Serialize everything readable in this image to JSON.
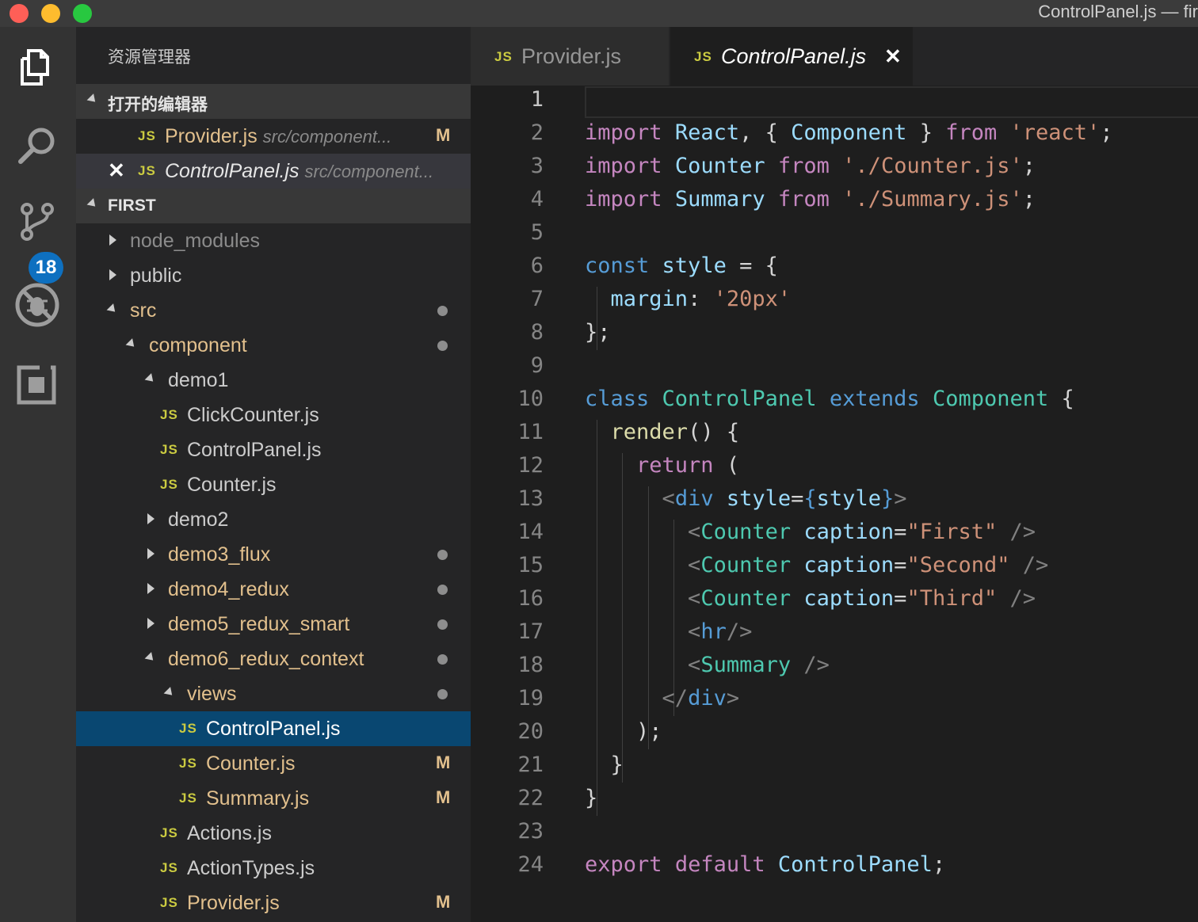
{
  "window": {
    "title": "ControlPanel.js — fir"
  },
  "activity_bar": {
    "items": [
      "explorer-icon",
      "search-icon",
      "source-control-icon",
      "debug-icon",
      "extensions-icon"
    ],
    "source_control_badge": "18"
  },
  "sidebar": {
    "title": "资源管理器",
    "open_editors_header": "打开的编辑器",
    "open_editors": [
      {
        "name": "Provider.js",
        "path": "src/component...",
        "status": "M"
      },
      {
        "name": "ControlPanel.js",
        "path": "src/component..."
      }
    ],
    "project_header": "FIRST",
    "tree": [
      {
        "label": "node_modules"
      },
      {
        "label": "public"
      },
      {
        "label": "src"
      },
      {
        "label": "component"
      },
      {
        "label": "demo1"
      },
      {
        "label": "ClickCounter.js"
      },
      {
        "label": "ControlPanel.js"
      },
      {
        "label": "Counter.js"
      },
      {
        "label": "demo2"
      },
      {
        "label": "demo3_flux"
      },
      {
        "label": "demo4_redux"
      },
      {
        "label": "demo5_redux_smart"
      },
      {
        "label": "demo6_redux_context"
      },
      {
        "label": "views"
      },
      {
        "label": "ControlPanel.js"
      },
      {
        "label": "Counter.js",
        "status": "M"
      },
      {
        "label": "Summary.js",
        "status": "M"
      },
      {
        "label": "Actions.js"
      },
      {
        "label": "ActionTypes.js"
      },
      {
        "label": "Provider.js",
        "status": "M"
      }
    ],
    "js_badge": "JS"
  },
  "tabs": [
    {
      "label": "Provider.js"
    },
    {
      "label": "ControlPanel.js",
      "close": "✕"
    }
  ],
  "colors": {
    "keyword": "#c586c0",
    "storage": "#569cd6",
    "class": "#4ec9b0",
    "variable": "#9cdcfe",
    "string": "#ce9178",
    "function": "#dcdcaa",
    "punct": "#d4d4d4",
    "tag_bracket": "#808080",
    "modified": "#e2c08d",
    "selection": "#094771"
  },
  "editor": {
    "lines": [
      {
        "n": "1",
        "tokens": []
      },
      {
        "n": "2",
        "tokens": [
          [
            "import",
            "keyword"
          ],
          [
            " ",
            "punct"
          ],
          [
            "React",
            "variable"
          ],
          [
            ", { ",
            "punct"
          ],
          [
            "Component",
            "variable"
          ],
          [
            " } ",
            "punct"
          ],
          [
            "from",
            "keyword"
          ],
          [
            " ",
            "punct"
          ],
          [
            "'react'",
            "string"
          ],
          [
            ";",
            "punct"
          ]
        ]
      },
      {
        "n": "3",
        "tokens": [
          [
            "import",
            "keyword"
          ],
          [
            " ",
            "punct"
          ],
          [
            "Counter",
            "variable"
          ],
          [
            " ",
            "punct"
          ],
          [
            "from",
            "keyword"
          ],
          [
            " ",
            "punct"
          ],
          [
            "'./Counter.js'",
            "string"
          ],
          [
            ";",
            "punct"
          ]
        ]
      },
      {
        "n": "4",
        "tokens": [
          [
            "import",
            "keyword"
          ],
          [
            " ",
            "punct"
          ],
          [
            "Summary",
            "variable"
          ],
          [
            " ",
            "punct"
          ],
          [
            "from",
            "keyword"
          ],
          [
            " ",
            "punct"
          ],
          [
            "'./Summary.js'",
            "string"
          ],
          [
            ";",
            "punct"
          ]
        ]
      },
      {
        "n": "5",
        "tokens": []
      },
      {
        "n": "6",
        "tokens": [
          [
            "const",
            "storage"
          ],
          [
            " ",
            "punct"
          ],
          [
            "style",
            "variable"
          ],
          [
            " = {",
            "punct"
          ]
        ]
      },
      {
        "n": "7",
        "tokens": [
          [
            "  ",
            "punct"
          ],
          [
            "margin",
            "variable"
          ],
          [
            ": ",
            "punct"
          ],
          [
            "'20px'",
            "string"
          ]
        ]
      },
      {
        "n": "8",
        "tokens": [
          [
            "};",
            "punct"
          ]
        ]
      },
      {
        "n": "9",
        "tokens": []
      },
      {
        "n": "10",
        "tokens": [
          [
            "class",
            "storage"
          ],
          [
            " ",
            "punct"
          ],
          [
            "ControlPanel",
            "class"
          ],
          [
            " ",
            "punct"
          ],
          [
            "extends",
            "storage"
          ],
          [
            " ",
            "punct"
          ],
          [
            "Component",
            "class"
          ],
          [
            " {",
            "punct"
          ]
        ]
      },
      {
        "n": "11",
        "tokens": [
          [
            "  ",
            "punct"
          ],
          [
            "render",
            "function"
          ],
          [
            "() {",
            "punct"
          ]
        ]
      },
      {
        "n": "12",
        "tokens": [
          [
            "    ",
            "punct"
          ],
          [
            "return",
            "keyword"
          ],
          [
            " (",
            "punct"
          ]
        ]
      },
      {
        "n": "13",
        "tokens": [
          [
            "      ",
            "punct"
          ],
          [
            "<",
            "tag_bracket"
          ],
          [
            "div",
            "storage"
          ],
          [
            " ",
            "punct"
          ],
          [
            "style",
            "variable"
          ],
          [
            "=",
            "punct"
          ],
          [
            "{",
            "storage"
          ],
          [
            "style",
            "variable"
          ],
          [
            "}",
            "storage"
          ],
          [
            ">",
            "tag_bracket"
          ]
        ]
      },
      {
        "n": "14",
        "tokens": [
          [
            "        ",
            "punct"
          ],
          [
            "<",
            "tag_bracket"
          ],
          [
            "Counter",
            "class"
          ],
          [
            " ",
            "punct"
          ],
          [
            "caption",
            "variable"
          ],
          [
            "=",
            "punct"
          ],
          [
            "\"First\"",
            "string"
          ],
          [
            " ",
            "punct"
          ],
          [
            "/>",
            "tag_bracket"
          ]
        ]
      },
      {
        "n": "15",
        "tokens": [
          [
            "        ",
            "punct"
          ],
          [
            "<",
            "tag_bracket"
          ],
          [
            "Counter",
            "class"
          ],
          [
            " ",
            "punct"
          ],
          [
            "caption",
            "variable"
          ],
          [
            "=",
            "punct"
          ],
          [
            "\"Second\"",
            "string"
          ],
          [
            " ",
            "punct"
          ],
          [
            "/>",
            "tag_bracket"
          ]
        ]
      },
      {
        "n": "16",
        "tokens": [
          [
            "        ",
            "punct"
          ],
          [
            "<",
            "tag_bracket"
          ],
          [
            "Counter",
            "class"
          ],
          [
            " ",
            "punct"
          ],
          [
            "caption",
            "variable"
          ],
          [
            "=",
            "punct"
          ],
          [
            "\"Third\"",
            "string"
          ],
          [
            " ",
            "punct"
          ],
          [
            "/>",
            "tag_bracket"
          ]
        ]
      },
      {
        "n": "17",
        "tokens": [
          [
            "        ",
            "punct"
          ],
          [
            "<",
            "tag_bracket"
          ],
          [
            "hr",
            "storage"
          ],
          [
            "/>",
            "tag_bracket"
          ]
        ]
      },
      {
        "n": "18",
        "tokens": [
          [
            "        ",
            "punct"
          ],
          [
            "<",
            "tag_bracket"
          ],
          [
            "Summary",
            "class"
          ],
          [
            " ",
            "punct"
          ],
          [
            "/>",
            "tag_bracket"
          ]
        ]
      },
      {
        "n": "19",
        "tokens": [
          [
            "      ",
            "punct"
          ],
          [
            "</",
            "tag_bracket"
          ],
          [
            "div",
            "storage"
          ],
          [
            ">",
            "tag_bracket"
          ]
        ]
      },
      {
        "n": "20",
        "tokens": [
          [
            "    );",
            "punct"
          ]
        ]
      },
      {
        "n": "21",
        "tokens": [
          [
            "  }",
            "punct"
          ]
        ]
      },
      {
        "n": "22",
        "tokens": [
          [
            "}",
            "punct"
          ]
        ]
      },
      {
        "n": "23",
        "tokens": []
      },
      {
        "n": "24",
        "tokens": [
          [
            "export",
            "keyword"
          ],
          [
            " ",
            "punct"
          ],
          [
            "default",
            "keyword"
          ],
          [
            " ",
            "punct"
          ],
          [
            "ControlPanel",
            "variable"
          ],
          [
            ";",
            "punct"
          ]
        ]
      }
    ]
  }
}
